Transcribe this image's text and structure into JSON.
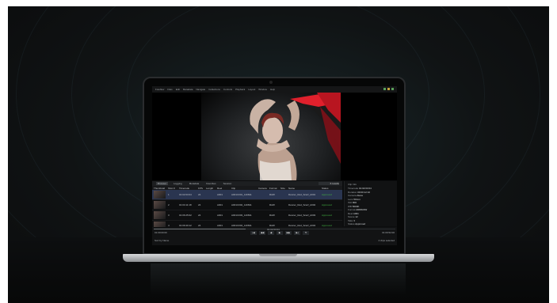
{
  "menubar": {
    "items": [
      "Fotoflow",
      "Files",
      "Edit",
      "Metadata",
      "Navigate",
      "Collections",
      "Controls",
      "Playback",
      "Layout",
      "Window",
      "Help"
    ]
  },
  "panel": {
    "tabs": [
      "Browser",
      "Logging",
      "Metadata",
      "Favorites",
      "Session"
    ],
    "search_value": "6 results",
    "headers": [
      "Thumbnail",
      "Shot #",
      "Timecode",
      "FPS",
      "Length",
      "Reel",
      "Clip",
      "Camera",
      "Format",
      "Size",
      "Name",
      "Status"
    ]
  },
  "clips": [
    {
      "num": "1",
      "timecode": "01:02:03:04",
      "fps": "24",
      "reel": "A001",
      "clip": "A001C001_140811",
      "fmt": "RAW",
      "name": "Dancer_Red_Scarf_A001",
      "status": "Approved",
      "selected": true
    },
    {
      "num": "2",
      "timecode": "01:04:11:18",
      "fps": "24",
      "reel": "A001",
      "clip": "A001C002_140811",
      "fmt": "RAW",
      "name": "Dancer_Red_Scarf_A002",
      "status": "Approved",
      "selected": false
    },
    {
      "num": "3",
      "timecode": "01:06:25:02",
      "fps": "24",
      "reel": "A001",
      "clip": "A001C003_140811",
      "fmt": "RAW",
      "name": "Dancer_Red_Scarf_A003",
      "status": "Approved",
      "selected": false
    },
    {
      "num": "4",
      "timecode": "01:09:40:12",
      "fps": "24",
      "reel": "A001",
      "clip": "A001C004_140811",
      "fmt": "RAW",
      "name": "Dancer_Red_Scarf_A004",
      "status": "Approved",
      "selected": false
    }
  ],
  "meta_panel": {
    "title": "Clip Info",
    "fields": [
      {
        "label": "Timecode",
        "value": "01:02:03:04"
      },
      {
        "label": "Duration",
        "value": "00:00:12:10"
      },
      {
        "label": "Camera",
        "value": "Alexa"
      },
      {
        "label": "Lens",
        "value": "50mm"
      },
      {
        "label": "ISO",
        "value": "800"
      },
      {
        "label": "WB",
        "value": "5600K"
      },
      {
        "label": "Format",
        "value": "ARRIRAW"
      },
      {
        "label": "Reel",
        "value": "A001"
      },
      {
        "label": "Scene",
        "value": "12"
      },
      {
        "label": "Take",
        "value": "3"
      },
      {
        "label": "Status",
        "value": "Approved"
      }
    ]
  },
  "transport": {
    "tc_in": "01:00:00:00",
    "tc_current": "01:02:03:04",
    "tc_out": "01:09:52:00",
    "buttons": [
      "|◀",
      "◀◀",
      "◀",
      "▶",
      "▶▶",
      "▶|",
      "⟲"
    ],
    "footer_left": "Sort by  Name",
    "footer_right": "4 clips selected",
    "progress": 0.38
  },
  "colors": {
    "accent_green": "#43b043",
    "selection": "#2a3550",
    "scarf_red": "#e0202c"
  }
}
